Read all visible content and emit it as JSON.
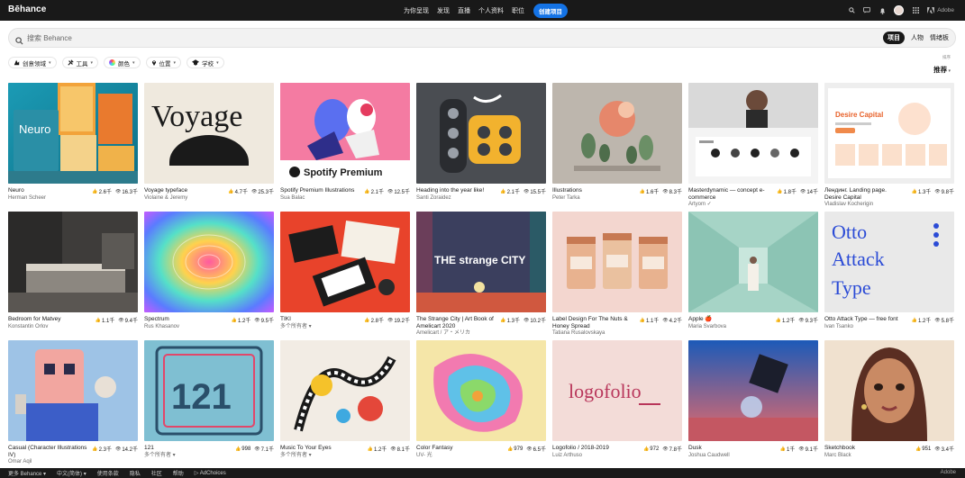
{
  "topbar": {
    "logo": "Bēhance",
    "nav": [
      "为你呈现",
      "发现",
      "直播",
      "个人资料",
      "职位"
    ],
    "create": "创建项目",
    "adobe": "Adobe"
  },
  "search": {
    "placeholder": "搜索 Behance",
    "scopes": [
      "项目",
      "人物",
      "情绪板"
    ]
  },
  "filters": [
    {
      "label": "创意领域",
      "icon": "creative-fields-icon"
    },
    {
      "label": "工具",
      "icon": "tools-icon"
    },
    {
      "label": "颜色",
      "icon": "color-icon"
    },
    {
      "label": "位置",
      "icon": "location-icon"
    },
    {
      "label": "学校",
      "icon": "school-icon"
    }
  ],
  "sort": {
    "label": "排序",
    "value": "推荐"
  },
  "projects": [
    {
      "title": "Neuro",
      "owner": "Herman Scheer",
      "likes": "2.6千",
      "views": "16.3千"
    },
    {
      "title": "Voyage typeface",
      "owner": "Violaine & Jeremy",
      "likes": "4.7千",
      "views": "25.3千",
      "thumb_text": "Voyage"
    },
    {
      "title": "Spotify Premium Illustrations",
      "owner": "Sua Balac",
      "likes": "2.1千",
      "views": "12.5千",
      "thumb_text": "Spotify Premium"
    },
    {
      "title": "Heading into the year like!",
      "owner": "Santi Zoraidez",
      "likes": "2.1千",
      "views": "15.5千"
    },
    {
      "title": "Illustrations",
      "owner": "Peter Tarka",
      "likes": "1.6千",
      "views": "8.3千"
    },
    {
      "title": "Masterdynamic — concept e-commerce",
      "owner": "Artyom ✓",
      "likes": "1.8千",
      "views": "14千"
    },
    {
      "title": "Лендинг. Landing page. Desire Capital",
      "owner": "Vladislav Kocherigin",
      "likes": "1.3千",
      "views": "9.8千",
      "thumb_text": "Desire Capital"
    },
    {
      "title": "Bedroom for Matvey",
      "owner": "Konstantin Orlov",
      "likes": "1.1千",
      "views": "9.4千"
    },
    {
      "title": "Spectrum",
      "owner": "Rus Khasanov",
      "likes": "1.2千",
      "views": "9.5千"
    },
    {
      "title": "TIKI",
      "owner": "多个所有者 ▾",
      "likes": "2.8千",
      "views": "19.2千"
    },
    {
      "title": "The Strange City | Art Book of Amelicart 2020",
      "owner": "Amelicart / ア・メリカ",
      "likes": "1.3千",
      "views": "10.2千",
      "thumb_text": "THE strange CITY"
    },
    {
      "title": "Label Design For The Nuts & Honey Spread",
      "owner": "Tatiana Rusalovskaya",
      "likes": "1.1千",
      "views": "4.2千"
    },
    {
      "title": "Apple 🍎",
      "owner": "Maria Svarbova",
      "likes": "1.2千",
      "views": "9.3千"
    },
    {
      "title": "Otto Attack Type — free font",
      "owner": "Ivan Tsanko",
      "likes": "1.2千",
      "views": "5.8千",
      "thumb_text": "Otto Attack Type"
    },
    {
      "title": "Casual (Character Illustrations IV)",
      "owner": "Omar Aqil",
      "likes": "2.3千",
      "views": "14.2千"
    },
    {
      "title": "121",
      "owner": "多个所有者 ▾",
      "likes": "998",
      "views": "7.1千",
      "thumb_text": "121"
    },
    {
      "title": "Music To Your Eyes",
      "owner": "多个所有者 ▾",
      "likes": "1.2千",
      "views": "8.1千"
    },
    {
      "title": "Color Fantasy",
      "owner": "UV- 光",
      "likes": "979",
      "views": "6.5千"
    },
    {
      "title": "Logofolio / 2018-2019",
      "owner": "Luiz Arthuso",
      "likes": "972",
      "views": "7.8千",
      "thumb_text": "logofolio"
    },
    {
      "title": "Dusk",
      "owner": "Joshua Caudwell",
      "likes": "1千",
      "views": "9.1千"
    },
    {
      "title": "Sketchbook",
      "owner": "Marc Black",
      "likes": "951",
      "views": "3.4千"
    }
  ],
  "footer": {
    "items": [
      "更多 Behance ▾",
      "中文(简体) ▾",
      "使用条款",
      "隐私",
      "社区",
      "帮助",
      "▷ AdChoices"
    ],
    "adobe": "Adobe"
  }
}
